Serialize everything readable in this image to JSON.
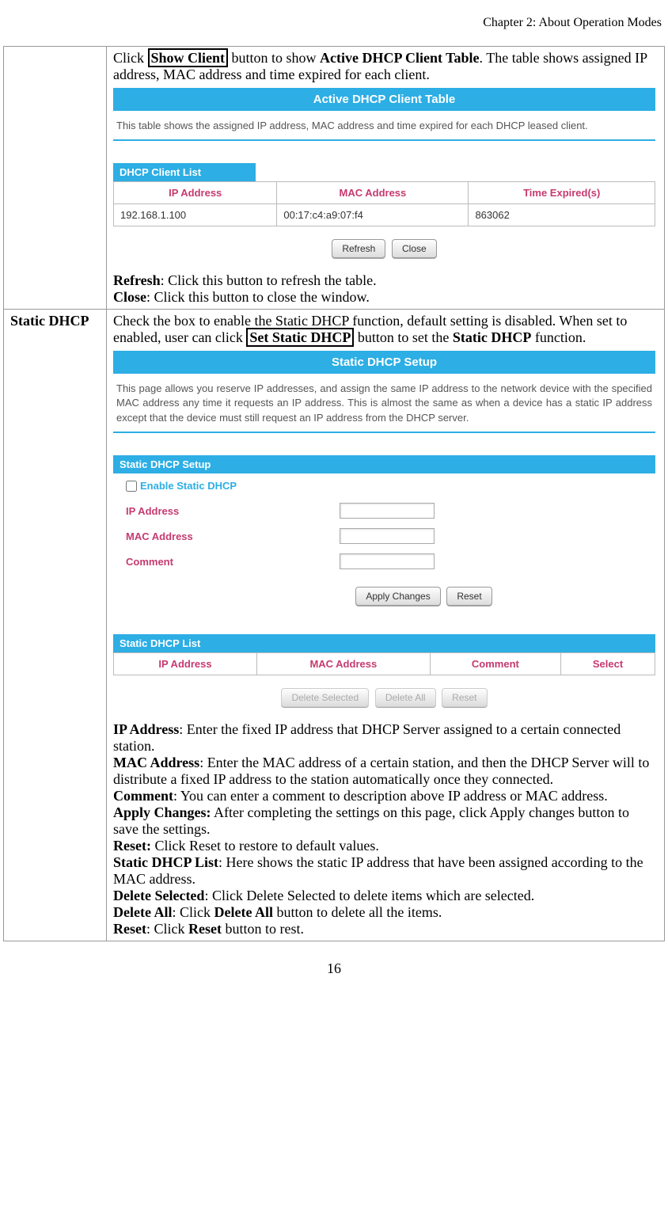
{
  "chapter_header": "Chapter 2: About Operation Modes",
  "page_number": "16",
  "row1": {
    "intro_a": "Click ",
    "show_client": "Show Client",
    "intro_b": " button to show ",
    "active_table": "Active DHCP Client Table",
    "intro_c": ". The table shows assigned IP address, MAC address and time expired for each client.",
    "refresh_label": "Refresh",
    "refresh_desc": ": Click this button to refresh the table.",
    "close_label": "Close",
    "close_desc": ": Click this button to close the window."
  },
  "panel1": {
    "title": "Active DHCP Client Table",
    "desc": "This table shows the assigned IP address, MAC address and time expired for each DHCP leased client.",
    "section": "DHCP Client List",
    "headers": {
      "ip": "IP Address",
      "mac": "MAC Address",
      "expire": "Time Expired(s)"
    },
    "rows": [
      {
        "ip": "192.168.1.100",
        "mac": "00:17:c4:a9:07:f4",
        "expire": "863062"
      }
    ],
    "btn_refresh": "Refresh",
    "btn_close": "Close"
  },
  "row2": {
    "label": "Static DHCP",
    "intro_a": "Check the box to enable the Static DHCP function, default setting is disabled. When set to enabled, user can click ",
    "set_static": "Set Static DHCP",
    "intro_b": " button to set the ",
    "static_dhcp_bold": "Static DHCP",
    "intro_c": " function."
  },
  "panel2": {
    "title": "Static DHCP Setup",
    "desc": "This page allows you reserve IP addresses, and assign the same IP address to the network device with the specified MAC address any time it requests an IP address. This is almost the same as when a device has a static IP address except that the device must still request an IP address from the DHCP server.",
    "section_setup": "Static DHCP Setup",
    "enable_label": "Enable Static DHCP",
    "ip_label": "IP Address",
    "mac_label": "MAC Address",
    "comment_label": "Comment",
    "btn_apply": "Apply Changes",
    "btn_reset": "Reset",
    "section_list": "Static DHCP List",
    "headers": {
      "ip": "IP Address",
      "mac": "MAC Address",
      "comment": "Comment",
      "select": "Select"
    },
    "btn_del_sel": "Delete Selected",
    "btn_del_all": "Delete All",
    "btn_reset2": "Reset"
  },
  "defs": {
    "ip_t": "IP Address",
    "ip_d": ": Enter the fixed IP address that DHCP Server assigned to a certain connected station.",
    "mac_t": "MAC Address",
    "mac_d": ": Enter the MAC address of a certain station, and then the DHCP Server will to distribute a fixed IP address to the station automatically once they connected.",
    "comment_t": "Comment",
    "comment_d": ": You can enter a comment to description above IP address or MAC address.",
    "apply_t": "Apply Changes:",
    "apply_d": " After completing the settings on this page, click Apply changes button to save the settings.",
    "reset1_t": "Reset:",
    "reset1_d": " Click Reset to restore to default values.",
    "list_t": "Static DHCP List",
    "list_d": ": Here shows the static IP address that have been assigned according to the MAC address.",
    "delsel_t": "Delete Selected",
    "delsel_d": ": Click Delete Selected to delete items which are selected.",
    "delall_t": "Delete All",
    "delall_a": ": Click ",
    "delall_btn": "Delete All",
    "delall_b": " button to delete all the items.",
    "reset2_t": "Reset",
    "reset2_a": ": Click ",
    "reset2_btn": "Reset",
    "reset2_b": " button to rest."
  }
}
